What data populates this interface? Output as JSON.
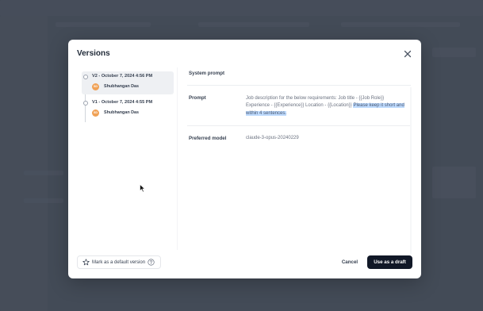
{
  "modal": {
    "title": "Versions",
    "close_icon": "close-icon"
  },
  "versions": [
    {
      "label": "V2 - October 7, 2024 4:56 PM",
      "author": "Shubhangan Das",
      "initials": "SD",
      "selected": true
    },
    {
      "label": "V1 - October 7, 2024 4:55 PM",
      "author": "Shubhangan Das",
      "initials": "SD",
      "selected": false
    }
  ],
  "details": {
    "system_prompt_label": "System prompt",
    "prompt_label": "Prompt",
    "prompt_text_plain": "Job description for the below requirements: Job title - {{Job Role}} Experience - {{Experience}} Location - {{Location}} ",
    "prompt_text_highlighted": "Please keep it short and within 4 sentences.",
    "preferred_model_label": "Preferred model",
    "preferred_model_value": "claude-3-opus-20240229"
  },
  "footer": {
    "default_label": "Mark as a default version",
    "cancel_label": "Cancel",
    "draft_label": "Use as a draft"
  },
  "colors": {
    "avatar": "#f0a155",
    "primary_button": "#111827",
    "highlight": "#bfdbfe"
  }
}
